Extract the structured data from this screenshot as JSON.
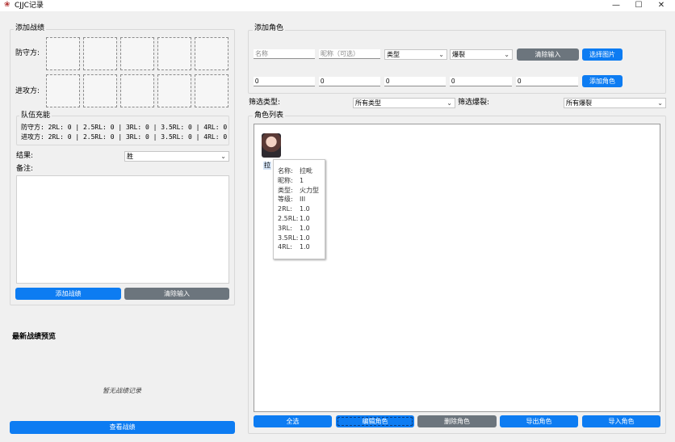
{
  "window": {
    "title": "CJJC记录",
    "minimize": "—",
    "maximize": "☐",
    "close": "✕"
  },
  "left": {
    "add_record_title": "添加战绩",
    "defender_label": "防守方:",
    "attacker_label": "进攻方:",
    "charge_title": "队伍充能",
    "defender_charge": "防守方: 2RL: 0 | 2.5RL: 0 | 3RL: 0 | 3.5RL: 0 | 4RL: 0",
    "attacker_charge": "进攻方: 2RL: 0 | 2.5RL: 0 | 3RL: 0 | 3.5RL: 0 | 4RL: 0",
    "result_label": "结果:",
    "result_value": "胜",
    "notes_label": "备注:",
    "add_record_button": "添加战绩",
    "clear_input_button": "清除输入",
    "preview_title": "最新战绩预览",
    "empty_text": "暂无战绩记录",
    "view_records_button": "查看战绩"
  },
  "right": {
    "add_role_title": "添加角色",
    "name_placeholder": "名称",
    "nickname_placeholder": "昵称（可选）",
    "type_select": "类型",
    "burst_select": "爆裂",
    "clear_input_button": "清除输入",
    "choose_image_button": "选择图片",
    "values": [
      "0",
      "0",
      "0",
      "0",
      "0"
    ],
    "add_role_button": "添加角色",
    "filter_type_label": "筛选类型:",
    "filter_type_value": "所有类型",
    "filter_burst_label": "筛选爆裂:",
    "filter_burst_value": "所有爆裂",
    "role_list_title": "角色列表",
    "role_card_name": "拉",
    "tooltip": [
      {
        "key": "名称:",
        "value": "拉毗"
      },
      {
        "key": "昵称:",
        "value": "1"
      },
      {
        "key": "类型:",
        "value": "火力型"
      },
      {
        "key": "等级:",
        "value": "III"
      },
      {
        "key": "2RL:",
        "value": "1.0"
      },
      {
        "key": "2.5RL:",
        "value": "1.0"
      },
      {
        "key": "3RL:",
        "value": "1.0"
      },
      {
        "key": "3.5RL:",
        "value": "1.0"
      },
      {
        "key": "4RL:",
        "value": "1.0"
      }
    ],
    "bottom_buttons": {
      "select_all": "全选",
      "edit_role": "编辑角色",
      "delete_role": "删除角色",
      "export_role": "导出角色",
      "import_role": "导入角色"
    }
  },
  "colors": {
    "primary": "#0d7cf2",
    "secondary": "#6c757d",
    "background": "#f0f0f0"
  }
}
